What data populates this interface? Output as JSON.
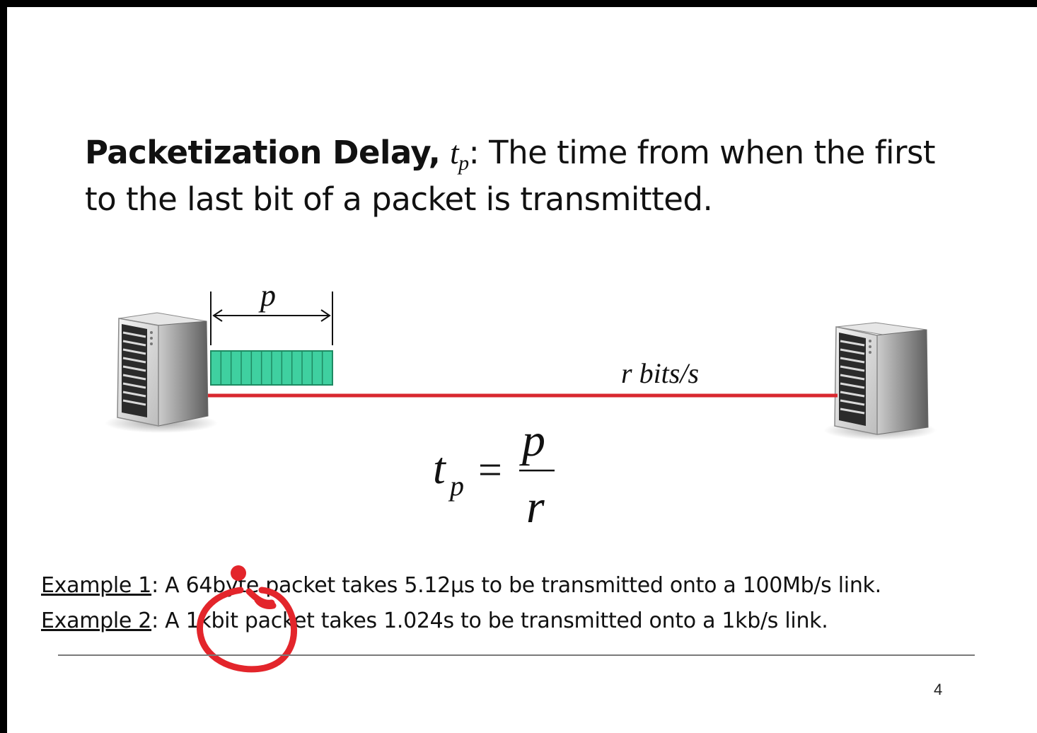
{
  "heading": {
    "term": "Packetization Delay,",
    "symbol_base": "t",
    "symbol_sub": "p",
    "colon": ":",
    "line1_rest": "The time from when the first",
    "line2": "to the last bit of a packet is transmitted."
  },
  "diagram": {
    "packet_label": "p",
    "link_label": "r bits/s",
    "packet_segments": 12,
    "colors": {
      "link": "#d9282f",
      "packet_fill": "#3fd0a0",
      "packet_stroke": "#1e8a62",
      "annotation": "#e3252b"
    },
    "formula": {
      "lhs_base": "t",
      "lhs_sub": "p",
      "equals": "=",
      "numerator": "p",
      "denominator": "r"
    }
  },
  "examples": [
    {
      "label": "Example 1",
      "sep": ": ",
      "text": "A 64byte packet takes 5.12µs to be transmitted onto a 100Mb/s link."
    },
    {
      "label": "Example 2",
      "sep": ": ",
      "text": "A 1kbit packet takes 1.024s to be transmitted onto a 1kb/s link."
    }
  ],
  "page_number": "4",
  "icons": [
    "server-left-icon",
    "server-right-icon",
    "annotation-circle-icon"
  ]
}
